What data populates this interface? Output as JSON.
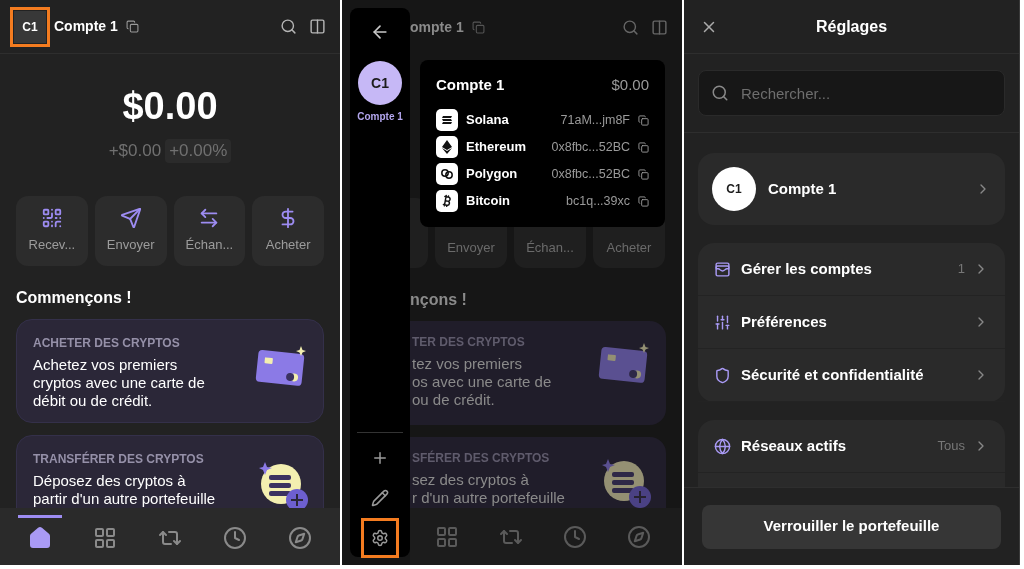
{
  "home": {
    "account": {
      "initials": "C1",
      "name": "Compte 1",
      "highlighted": true
    },
    "balance": "$0.00",
    "change": "+$0.00",
    "change_percent": "+0.00%",
    "actions": [
      {
        "kind": "receive",
        "label": "Recev..."
      },
      {
        "kind": "send",
        "label": "Envoyer"
      },
      {
        "kind": "swap",
        "label": "Échan..."
      },
      {
        "kind": "buy",
        "label": "Acheter"
      }
    ],
    "section_title": "Commençons !",
    "cards": [
      {
        "kind": "card",
        "eyebrow": "ACHETER DES CRYPTOS",
        "lines": [
          "Achetez vos premiers",
          "cryptos avec une carte de",
          "débit ou de crédit."
        ]
      },
      {
        "kind": "coin",
        "eyebrow": "TRANSFÉRER DES CRYPTOS",
        "lines": [
          "Déposez des cryptos à",
          "partir d'un autre portefeuille"
        ]
      }
    ],
    "nav": [
      {
        "kind": "home",
        "selected": true
      },
      {
        "kind": "grid",
        "selected": false
      },
      {
        "kind": "swap",
        "selected": false
      },
      {
        "kind": "history",
        "selected": false
      },
      {
        "kind": "explore",
        "selected": false
      }
    ]
  },
  "switcher": {
    "background": {
      "name": "ompte 1",
      "actions": [
        "Envoyer",
        "Échan...",
        "Acheter"
      ],
      "section_title": "nçons !",
      "cards": [
        {
          "kind": "card",
          "eyebrow": "TER DES CRYPTOS",
          "lines": [
            "tez vos premiers",
            "os avec une carte de",
            "ou de crédit."
          ]
        },
        {
          "kind": "coin",
          "eyebrow": "SFÉRER DES CRYPTOS",
          "lines": [
            "sez des cryptos à",
            "r d'un autre portefeuille"
          ]
        }
      ],
      "nav": [
        {
          "kind": "grid"
        },
        {
          "kind": "swap"
        },
        {
          "kind": "history"
        },
        {
          "kind": "explore"
        }
      ]
    },
    "accounts": [
      {
        "initials": "C1",
        "name": "Compte 1"
      }
    ],
    "tools": [
      {
        "kind": "add",
        "highlighted": false
      },
      {
        "kind": "edit",
        "highlighted": false
      },
      {
        "kind": "settings",
        "highlighted": true
      }
    ],
    "popover": {
      "name": "Compte 1",
      "balance": "$0.00",
      "addresses": [
        {
          "kind": "solana",
          "network": "Solana",
          "address": "71aM...jm8F"
        },
        {
          "kind": "ethereum",
          "network": "Ethereum",
          "address": "0x8fbc...52BC"
        },
        {
          "kind": "polygon",
          "network": "Polygon",
          "address": "0x8fbc...52BC"
        },
        {
          "kind": "bitcoin",
          "network": "Bitcoin",
          "address": "bc1q...39xc"
        }
      ]
    }
  },
  "settings": {
    "title": "Réglages",
    "search_placeholder": "Rechercher...",
    "account": {
      "initials": "C1",
      "name": "Compte 1"
    },
    "groups": [
      [
        {
          "kind": "wallet",
          "label": "Gérer les comptes",
          "value": "1"
        },
        {
          "kind": "sliders",
          "label": "Préférences"
        },
        {
          "kind": "shield",
          "label": "Sécurité et confidentialité"
        }
      ],
      [
        {
          "kind": "globe",
          "label": "Réseaux actifs",
          "value": "Tous"
        }
      ]
    ],
    "lock_button": "Verrouiller le portefeuille"
  }
}
